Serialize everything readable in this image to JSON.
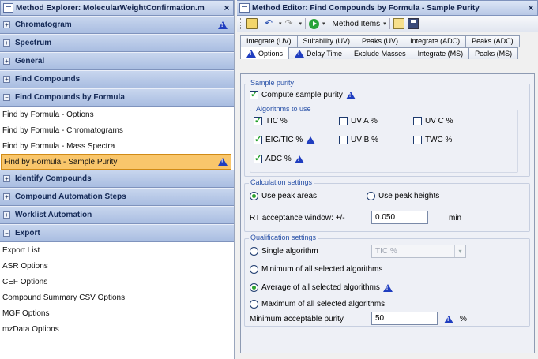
{
  "left_panel": {
    "title": "Method Explorer: MolecularWeightConfirmation.m",
    "close": "×",
    "sections": {
      "chromatogram": "Chromatogram",
      "spectrum": "Spectrum",
      "general": "General",
      "find_compounds": "Find Compounds",
      "find_by_formula": "Find Compounds by Formula",
      "identify": "Identify Compounds",
      "automation": "Compound Automation Steps",
      "worklist": "Worklist Automation",
      "export": "Export"
    },
    "expand_plus": "+",
    "expand_minus": "−",
    "formula_items": [
      "Find by Formula - Options",
      "Find by Formula - Chromatograms",
      "Find by Formula - Mass Spectra",
      "Find by Formula - Sample Purity"
    ],
    "export_items": [
      "Export List",
      "ASR Options",
      "CEF Options",
      "Compound Summary CSV Options",
      "MGF Options",
      "mzData Options"
    ]
  },
  "right_panel": {
    "title": "Method Editor: Find Compounds by Formula - Sample Purity",
    "close": "×",
    "toolbar": {
      "method_items": "Method Items",
      "dropdown": "▾"
    },
    "tabs_row1": [
      "Integrate (UV)",
      "Suitability (UV)",
      "Peaks (UV)",
      "Integrate (ADC)",
      "Peaks (ADC)"
    ],
    "tabs_row2": [
      "Options",
      "Delay Time",
      "Exclude Masses",
      "Integrate (MS)",
      "Peaks (MS)"
    ],
    "sample_purity": {
      "label": "Sample purity",
      "compute": "Compute sample purity",
      "algorithms_label": "Algorithms to use",
      "tic": "TIC %",
      "uva": "UV A %",
      "uvc": "UV C %",
      "eic_tic": "EIC/TIC %",
      "uvb": "UV B %",
      "twc": "TWC %",
      "adc": "ADC %"
    },
    "calculation": {
      "label": "Calculation settings",
      "use_areas": "Use peak areas",
      "use_heights": "Use peak heights",
      "rt_label": "RT acceptance window: +/-",
      "rt_value": "0.050",
      "rt_unit": "min"
    },
    "qualification": {
      "label": "Qualification settings",
      "single": "Single algorithm",
      "single_select": "TIC %",
      "minimum": "Minimum of all selected algorithms",
      "average": "Average of all selected algorithms",
      "maximum": "Maximum of all selected algorithms",
      "min_purity_label": "Minimum acceptable purity",
      "min_purity_value": "50",
      "min_purity_unit": "%"
    }
  },
  "colors": {
    "header_blue": "#b8c8e6",
    "selected_item": "#f9c66b",
    "group_label": "#2a52a8",
    "warning_icon": "#1f3dbf"
  }
}
